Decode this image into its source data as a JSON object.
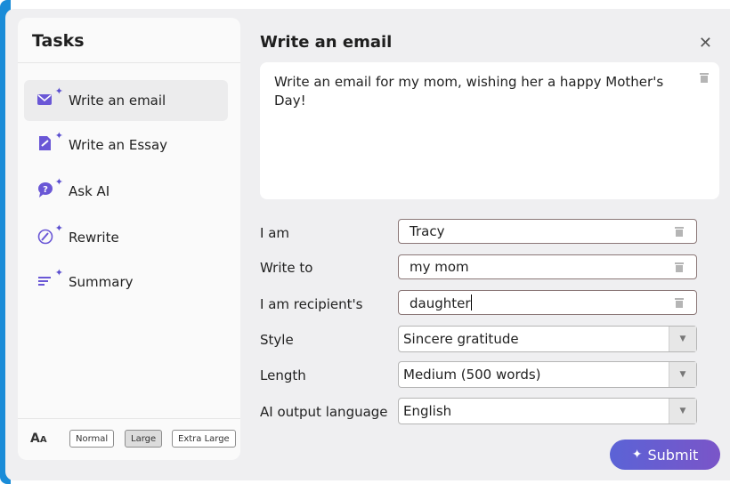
{
  "sidebar": {
    "title": "Tasks",
    "items": [
      {
        "label": "Write an email",
        "icon": "mail-sparkle-icon",
        "selected": true
      },
      {
        "label": "Write an Essay",
        "icon": "document-edit-sparkle-icon",
        "selected": false
      },
      {
        "label": "Ask AI",
        "icon": "chat-question-sparkle-icon",
        "selected": false
      },
      {
        "label": "Rewrite",
        "icon": "magic-wand-sparkle-icon",
        "selected": false
      },
      {
        "label": "Summary",
        "icon": "text-lines-sparkle-icon",
        "selected": false
      }
    ],
    "font_size": {
      "icon": "font-size-icon",
      "options": [
        "Normal",
        "Large",
        "Extra Large"
      ],
      "selected": "Large"
    }
  },
  "main": {
    "title": "Write an email",
    "prompt": "Write an email for my mom, wishing her a happy Mother's Day!",
    "fields": {
      "i_am": {
        "label": "I am",
        "value": "Tracy"
      },
      "write_to": {
        "label": "Write to",
        "value": "my mom"
      },
      "recipient_relation": {
        "label": "I am recipient's",
        "value": "daughter"
      }
    },
    "selects": {
      "style": {
        "label": "Style",
        "value": "Sincere gratitude"
      },
      "length": {
        "label": "Length",
        "value": "Medium (500 words)"
      },
      "language": {
        "label": "AI output language",
        "value": "English"
      }
    },
    "submit_label": "Submit"
  },
  "colors": {
    "accent_purple": "#5b4fcf",
    "submit_gradient_start": "#5b63d6",
    "submit_gradient_end": "#7a55c8",
    "window_bg": "#efeff1",
    "left_edge_blue": "#1a8cd8"
  }
}
